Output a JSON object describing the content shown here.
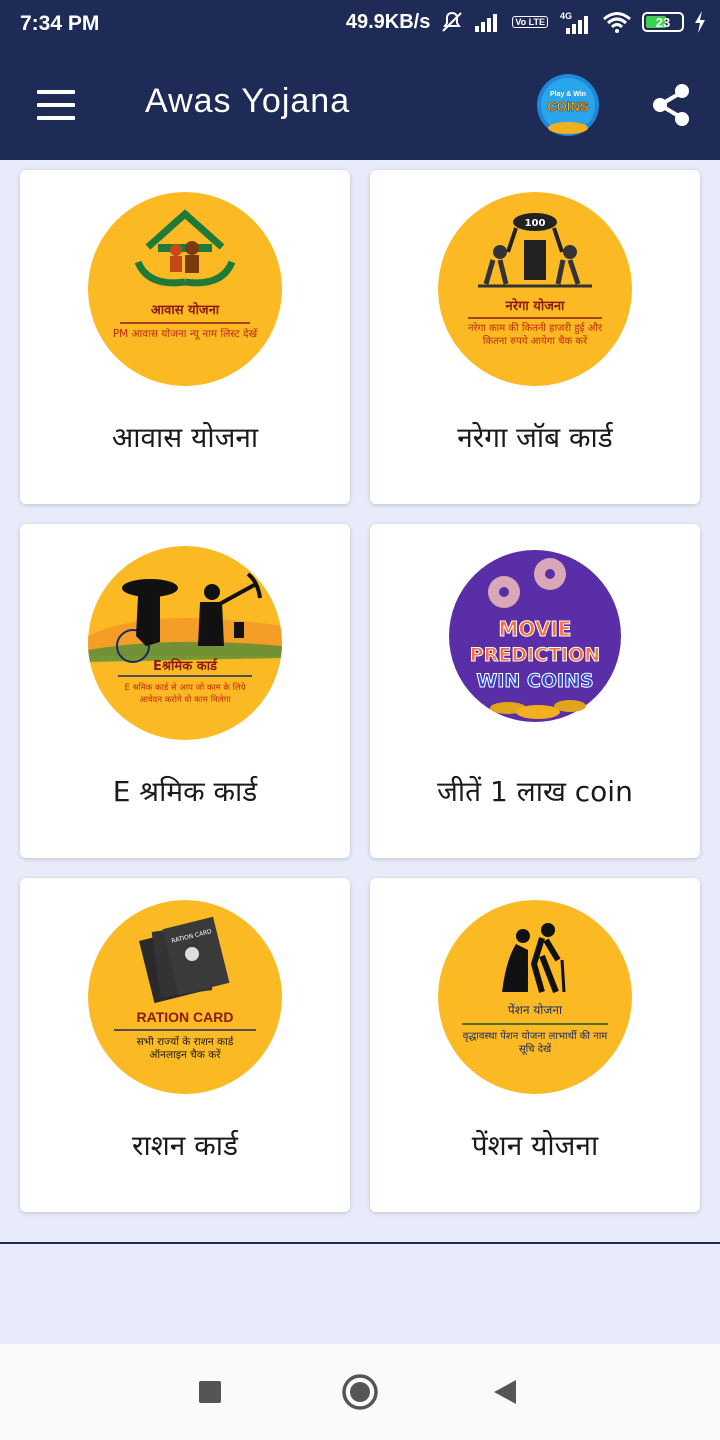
{
  "status_bar": {
    "time": "7:34 PM",
    "network_speed": "49.9KB/s",
    "battery": "23",
    "lte_badge": "Vo LTE",
    "signal_2_label": "4G"
  },
  "app_bar": {
    "title": "Awas Yojana",
    "coins_badge_top": "Play & Win",
    "coins_badge_main": "COINS"
  },
  "cards": [
    {
      "label": "आवास योजना",
      "badge_title": "आवास योजना",
      "badge_text": "PM आवास योजना न्यू नाम लिस्ट देखें"
    },
    {
      "label": "नरेगा जॉब कार्ड",
      "badge_title": "नरेगा योजना",
      "badge_text": "नरेगा काम की कितनी हाजरी हुई और कितना रुपये आयेगा चैक करें",
      "badge_number": "100"
    },
    {
      "label": "E श्रमिक कार्ड",
      "badge_title": "Eश्रमिक कार्ड",
      "badge_text": "E श्रमिक कार्ड से आप जो काम के लिये आवेदन करोगे वो काम मिलेगा"
    },
    {
      "label": "जीतें 1 लाख coin",
      "badge_line1": "MOVIE",
      "badge_line2": "PREDICTION",
      "badge_line3": "WIN COINS"
    },
    {
      "label": "राशन कार्ड",
      "badge_title": "RATION CARD",
      "badge_text": "सभी राज्यों के राशन कार्ड ऑनलाइन चैक करें",
      "card_text": "RATION CARD"
    },
    {
      "label": "पेंशन योजना",
      "badge_title": "पेंशन योजना",
      "badge_text": "वृद्धावस्था पेंशन योजना लाभार्थी की नाम सूचि देखें"
    }
  ],
  "colors": {
    "primary": "#1f2b57",
    "background": "#e8ebfa",
    "badge": "#fbb923",
    "badge_dark_red": "#8b1a0f",
    "movie_purple": "#5a2ea6"
  }
}
